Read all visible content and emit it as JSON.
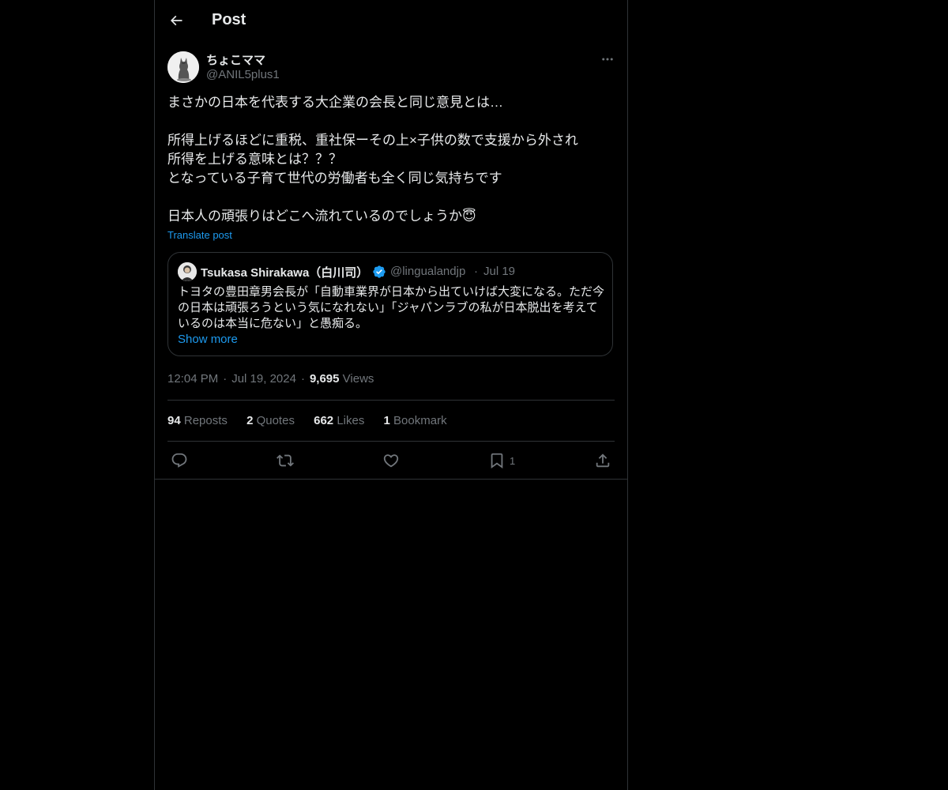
{
  "header": {
    "title": "Post"
  },
  "post": {
    "author_name": "ちょこママ",
    "author_handle": "@ANIL5plus1",
    "text_lines": [
      "まさかの日本を代表する大企業の会長と同じ意見とは…",
      "",
      "所得上げるほどに重税、重社保ーその上×子供の数で支援から外され",
      "所得を上げる意味とは？？？",
      "となっている子育て世代の労働者も全く同じ気持ちです",
      "",
      "日本人の頑張りはどこへ流れているのでしょうか😇"
    ],
    "translate_label": "Translate post",
    "time": "12:04 PM",
    "date": "Jul 19, 2024",
    "views_count": "9,695",
    "views_label": "Views",
    "dot": "·"
  },
  "quote": {
    "author_name": "Tsukasa Shirakawa（白川司）",
    "author_handle": "@lingualandjp",
    "dot": "·",
    "date": "Jul 19",
    "text_lines": [
      "トヨタの豊田章男会長が「自動車業界が日本から出ていけば大変になる。ただ今",
      "の日本は頑張ろうという気になれない」「ジャパンラブの私が日本脱出を考えて",
      "いるのは本当に危ない」と愚痴る。"
    ],
    "show_more_label": "Show more"
  },
  "stats": {
    "reposts_count": "94",
    "reposts_label": "Reposts",
    "quotes_count": "2",
    "quotes_label": "Quotes",
    "likes_count": "662",
    "likes_label": "Likes",
    "bookmarks_count": "1",
    "bookmarks_label": "Bookmark"
  },
  "actions": {
    "bookmark_count": "1"
  },
  "colors": {
    "background": "#000000",
    "text": "#e7e9ea",
    "muted": "#71767b",
    "link": "#1d9bf0",
    "border": "#2f3336",
    "verified": "#1d9bf0"
  },
  "icons": {
    "back": "arrow-left-icon",
    "more": "more-horizontal-icon",
    "verified": "verified-badge-icon",
    "reply": "reply-icon",
    "repost": "repost-icon",
    "like": "heart-icon",
    "bookmark": "bookmark-icon",
    "share": "share-icon"
  }
}
